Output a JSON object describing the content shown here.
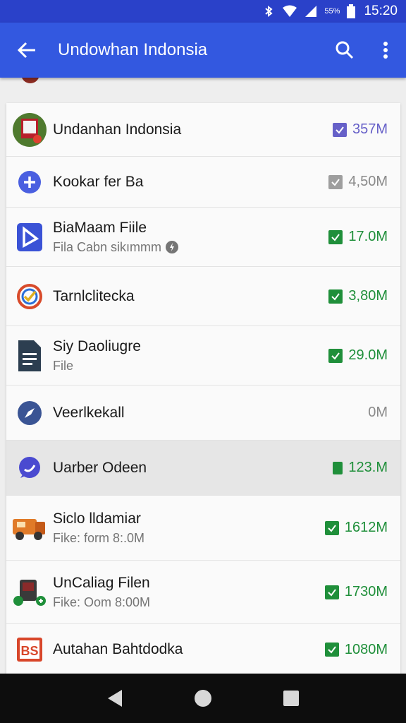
{
  "status_bar": {
    "battery_percent": "55%",
    "time": "15:20",
    "icons": [
      "bluetooth-icon",
      "wifi-icon",
      "signal-icon",
      "battery-icon"
    ]
  },
  "app_bar": {
    "title": "Undowhan Indonsia",
    "icons": [
      "back-arrow-icon",
      "search-icon",
      "more-vert-icon"
    ]
  },
  "colors": {
    "app_bar": "#3358e0",
    "status_bar": "#2a41c9",
    "check_green": "#1f8f3a",
    "check_grey": "#9e9e9e",
    "check_purple": "#6660c8"
  },
  "rows": [
    {
      "name": "Undanhan Indonsia",
      "sub": "",
      "size": "357M",
      "check": "purple",
      "icon": "flag-book-icon"
    },
    {
      "name": "Kookar fer Ba",
      "sub": "",
      "size": "4,50M",
      "check": "grey",
      "icon": "plus-circle-icon"
    },
    {
      "name": "BiaMaam Fiile",
      "sub": "Fila Cabn sikımmm",
      "size": "17.0M",
      "check": "green",
      "icon": "d-logo-icon"
    },
    {
      "name": "Tarnlclitecka",
      "sub": "",
      "size": "3,80M",
      "check": "green",
      "icon": "color-ring-icon"
    },
    {
      "name": "Siy Daoliugre",
      "sub": "File",
      "size": "29.0M",
      "check": "green",
      "icon": "document-icon"
    },
    {
      "name": "Veerlkekall",
      "sub": "",
      "size": "0M",
      "check": "none",
      "icon": "compass-icon"
    },
    {
      "name": "Uarber Odeen",
      "sub": "",
      "size": "123.M",
      "check": "green-solid",
      "icon": "chat-bubble-icon"
    },
    {
      "name": "Siclo lldamiar",
      "sub": "Fike: form 8:.0M",
      "size": "1612M",
      "check": "green",
      "icon": "truck-icon"
    },
    {
      "name": "UnCaliag Filen",
      "sub": "Fike: Oom 8:00M",
      "size": "1730M",
      "check": "green",
      "icon": "game-console-icon"
    },
    {
      "name": "Autahan Bahtdodka",
      "sub": "",
      "size": "1080M",
      "check": "green",
      "icon": "bs-logo-icon"
    }
  ],
  "nav_bar": {
    "icons": [
      "back-triangle-icon",
      "home-circle-icon",
      "recents-square-icon"
    ]
  }
}
